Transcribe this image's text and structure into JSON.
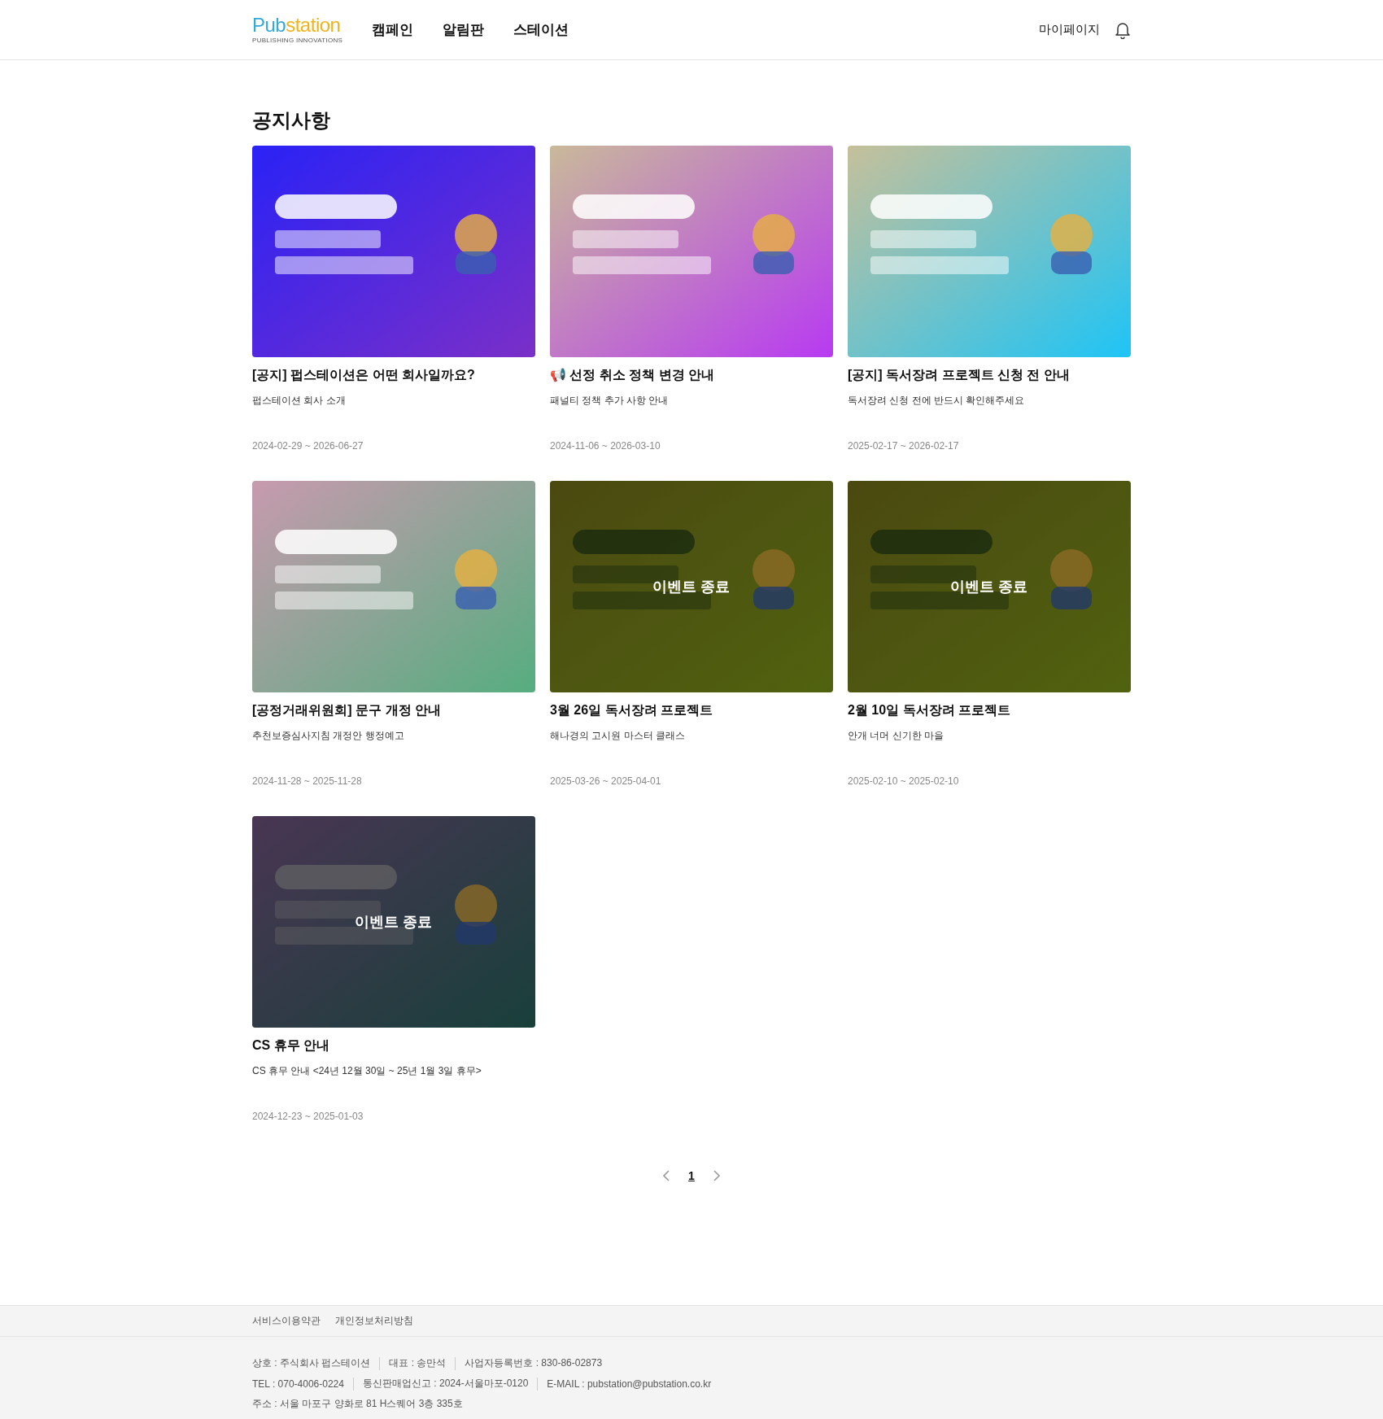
{
  "header": {
    "logo": {
      "lead": "Pub",
      "tail": "station",
      "tagline": "PUBLISHING INNOVATIONS"
    },
    "nav": [
      {
        "label": "캠페인"
      },
      {
        "label": "알림판"
      },
      {
        "label": "스테이션"
      }
    ],
    "mypage": "마이페이지"
  },
  "page_title": "공지사항",
  "cards": [
    {
      "ended": false,
      "title": "[공지] 펍스테이션은 어떤 회사일까요?",
      "subtitle": "펍스테이션 회사 소개",
      "period": "2024-02-29 ~ 2026-06-27"
    },
    {
      "ended": false,
      "title": "📢 선정 취소 정책 변경 안내",
      "subtitle": "패널티 정책 추가 사항 안내",
      "period": "2024-11-06 ~ 2026-03-10"
    },
    {
      "ended": false,
      "title": "[공지] 독서장려 프로젝트 신청 전 안내",
      "subtitle": "독서장려 신청 전에 반드시 확인해주세요",
      "period": "2025-02-17 ~ 2026-02-17"
    },
    {
      "ended": false,
      "title": "[공정거래위원회] 문구 개정 안내",
      "subtitle": "추천보증심사지침 개정안 행정예고",
      "period": "2024-11-28 ~ 2025-11-28"
    },
    {
      "ended": true,
      "overlay_label": "이벤트 종료",
      "title": "3월 26일 독서장려 프로젝트",
      "subtitle": "해나경의 고시원 마스터 클래스",
      "period": "2025-03-26 ~ 2025-04-01"
    },
    {
      "ended": true,
      "overlay_label": "이벤트 종료",
      "title": "2월 10일 독서장려 프로젝트",
      "subtitle": "안개 너머 신기한 마을",
      "period": "2025-02-10 ~ 2025-02-10"
    },
    {
      "ended": true,
      "overlay_label": "이벤트 종료",
      "title": "CS 휴무 안내",
      "subtitle": "CS 휴무 안내 <24년 12월 30일 ~ 25년 1월 3일 휴무>",
      "period": "2024-12-23 ~ 2025-01-03"
    }
  ],
  "pagination": {
    "pages": [
      {
        "label": "1",
        "selected": true
      }
    ]
  },
  "footer": {
    "links": [
      "서비스이용약관",
      "개인정보처리방침"
    ],
    "info_lines": [
      [
        "상호 : 주식회사 펍스테이션",
        "대표 : 송만석",
        "사업자등록번호 : 830-86-02873"
      ],
      [
        "TEL : 070-4006-0224",
        "통신판매업신고 : 2024-서울마포-0120",
        "E-MAIL : pubstation@pubstation.co.kr"
      ],
      [
        "주소 : 서울 마포구 양화로 81 H스퀘어 3층 335호"
      ]
    ]
  }
}
